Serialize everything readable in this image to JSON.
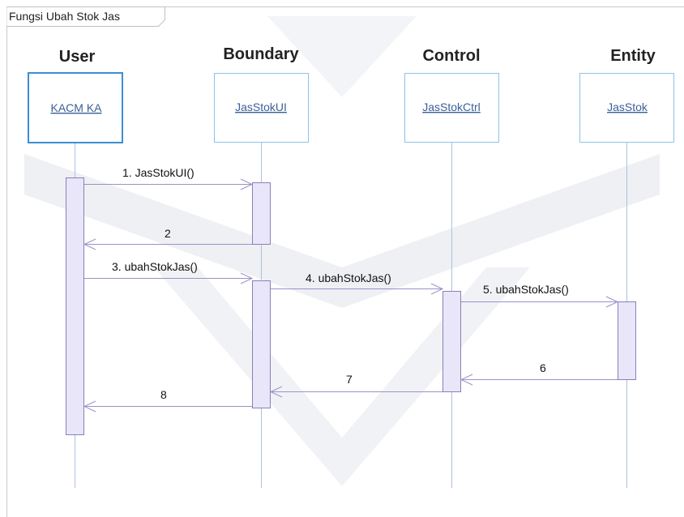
{
  "frame": {
    "title": "Fungsi Ubah Stok Jas"
  },
  "columns": [
    {
      "header": "User",
      "object": "KACM KA"
    },
    {
      "header": "Boundary",
      "object": "JasStokUI"
    },
    {
      "header": "Control",
      "object": "JasStokCtrl"
    },
    {
      "header": "Entity",
      "object": "JasStok"
    }
  ],
  "messages": [
    {
      "label": "1. JasStokUI()",
      "from": "User",
      "to": "Boundary",
      "kind": "call"
    },
    {
      "label": "2",
      "from": "Boundary",
      "to": "User",
      "kind": "return"
    },
    {
      "label": "3. ubahStokJas()",
      "from": "User",
      "to": "Boundary",
      "kind": "call"
    },
    {
      "label": "4. ubahStokJas()",
      "from": "Boundary",
      "to": "Control",
      "kind": "call"
    },
    {
      "label": "5. ubahStokJas()",
      "from": "Control",
      "to": "Entity",
      "kind": "call"
    },
    {
      "label": "6",
      "from": "Entity",
      "to": "Control",
      "kind": "return"
    },
    {
      "label": "7",
      "from": "Control",
      "to": "Boundary",
      "kind": "return"
    },
    {
      "label": "8",
      "from": "Boundary",
      "to": "User",
      "kind": "return"
    }
  ],
  "colors": {
    "frame_border": "#c8c8c8",
    "actor_box_stroke": "#3a8fd6",
    "object_box_stroke": "#8cc3ea",
    "object_text": "#3a5f9a",
    "lifeline": "#a9c3df",
    "activation_fill": "#e8e6f8",
    "activation_stroke": "#8a7fb8",
    "message_line": "#9a92c8",
    "watermark": "#eef0f4"
  }
}
